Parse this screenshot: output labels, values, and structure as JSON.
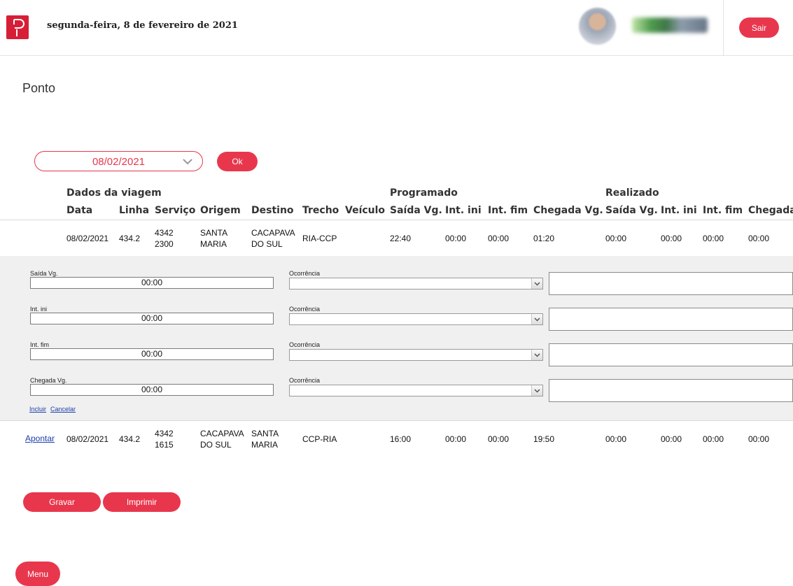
{
  "header": {
    "date": "segunda-feira, 8 de fevereiro de 2021",
    "logout_label": "Sair"
  },
  "page": {
    "title": "Ponto"
  },
  "filter": {
    "date_value": "08/02/2021",
    "ok_label": "Ok"
  },
  "table": {
    "groups": {
      "trip": "Dados da viagem",
      "scheduled": "Programado",
      "actual": "Realizado"
    },
    "columns": [
      "Data",
      "Linha",
      "Serviço",
      "Origem",
      "Destino",
      "Trecho",
      "Veículo",
      "Saída Vg.",
      "Int. ini",
      "Int. fim",
      "Chegada Vg.",
      "Saída Vg.",
      "Int. ini",
      "Int. fim",
      "Chegada"
    ],
    "rows": [
      {
        "action": "",
        "data": "08/02/2021",
        "linha": "434.2",
        "servico_1": "4342",
        "servico_2": "2300",
        "origem_1": "SANTA",
        "origem_2": "MARIA",
        "destino_1": "CACAPAVA",
        "destino_2": "DO SUL",
        "trecho": "RIA-CCP",
        "veiculo": "",
        "p_saida": "22:40",
        "p_ini": "00:00",
        "p_fim": "00:00",
        "p_chegada": "01:20",
        "r_saida": "00:00",
        "r_ini": "00:00",
        "r_fim": "00:00",
        "r_chegada": "00:00"
      },
      {
        "action": "Apontar",
        "data": "08/02/2021",
        "linha": "434.2",
        "servico_1": "4342",
        "servico_2": "1615",
        "origem_1": "CACAPAVA",
        "origem_2": "DO SUL",
        "destino_1": "SANTA",
        "destino_2": "MARIA",
        "trecho": "CCP-RIA",
        "veiculo": "",
        "p_saida": "16:00",
        "p_ini": "00:00",
        "p_fim": "00:00",
        "p_chegada": "19:50",
        "r_saida": "00:00",
        "r_ini": "00:00",
        "r_fim": "00:00",
        "r_chegada": "00:00"
      }
    ]
  },
  "edit_form": {
    "fields": [
      {
        "label": "Saída Vg.",
        "value": "00:00",
        "occurrence_label": "Ocorrência",
        "occurrence_value": ""
      },
      {
        "label": "Int. ini",
        "value": "00:00",
        "occurrence_label": "Ocorrência",
        "occurrence_value": ""
      },
      {
        "label": "Int. fim",
        "value": "00:00",
        "occurrence_label": "Ocorrência",
        "occurrence_value": ""
      },
      {
        "label": "Chegada Vg.",
        "value": "00:00",
        "occurrence_label": "Ocorrência",
        "occurrence_value": ""
      }
    ],
    "include_label": "Incluir",
    "cancel_label": "Cancelar"
  },
  "actions": {
    "save_label": "Gravar",
    "print_label": "Imprimir",
    "menu_label": "Menu"
  },
  "colors": {
    "accent": "#e8374d",
    "brand": "#d61f36",
    "link": "#1a3faa",
    "panel": "#f0f0f0"
  }
}
